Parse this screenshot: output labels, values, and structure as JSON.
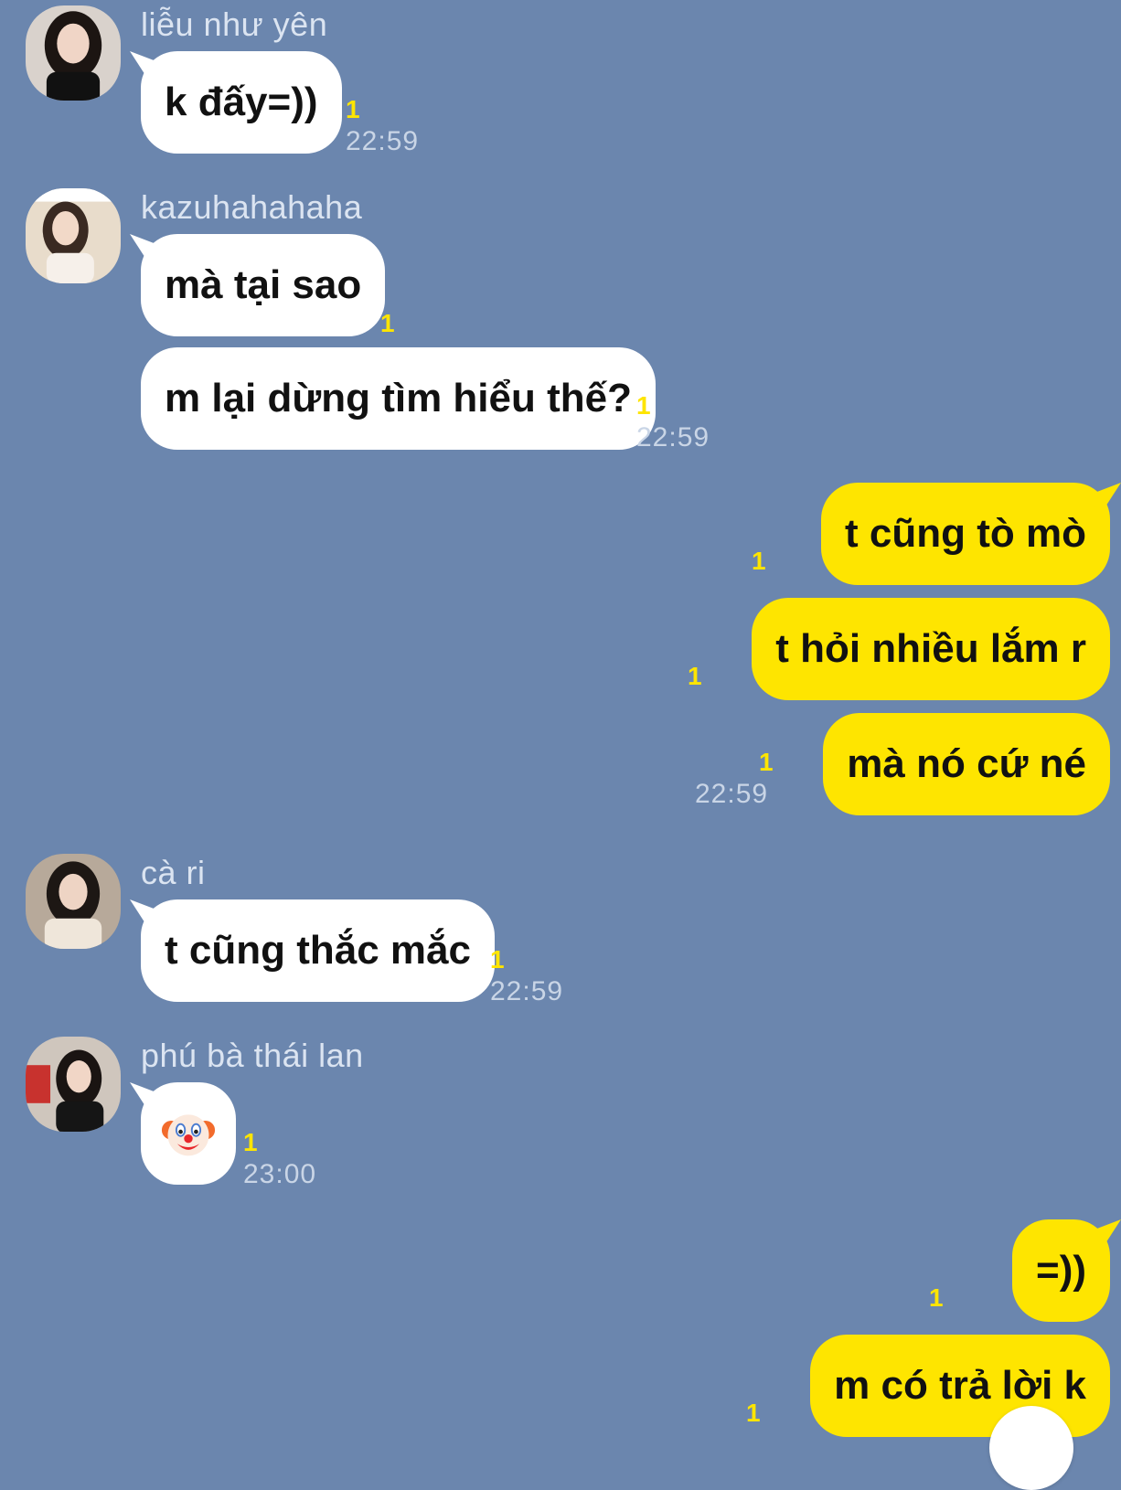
{
  "messages": [
    {
      "sender": "liễu như yên",
      "text": "k đấy=))",
      "unread": "1",
      "time": "22:59"
    },
    {
      "sender": "kazuhahahaha",
      "text": "mà tại sao",
      "unread": "1"
    },
    {
      "text": "m lại dừng tìm hiểu thế?",
      "unread": "1",
      "time": "22:59"
    },
    {
      "text": "t cũng tò mò",
      "unread": "1"
    },
    {
      "text": "t hỏi nhiều lắm r",
      "unread": "1"
    },
    {
      "text": "mà nó cứ né",
      "unread": "1",
      "time": "22:59"
    },
    {
      "sender": "cà ri",
      "text": "t cũng thắc mắc",
      "unread": "1",
      "time": "22:59"
    },
    {
      "sender": "phú bà thái lan",
      "emoji": "clown-face",
      "unread": "1",
      "time": "23:00"
    },
    {
      "text": "=))",
      "unread": "1"
    },
    {
      "text": "m có trả lời k",
      "unread": "1"
    }
  ],
  "colors": {
    "background": "#6b86ae",
    "outgoing_bubble": "#fee500",
    "incoming_bubble": "#ffffff",
    "unread_count": "#fee500"
  }
}
